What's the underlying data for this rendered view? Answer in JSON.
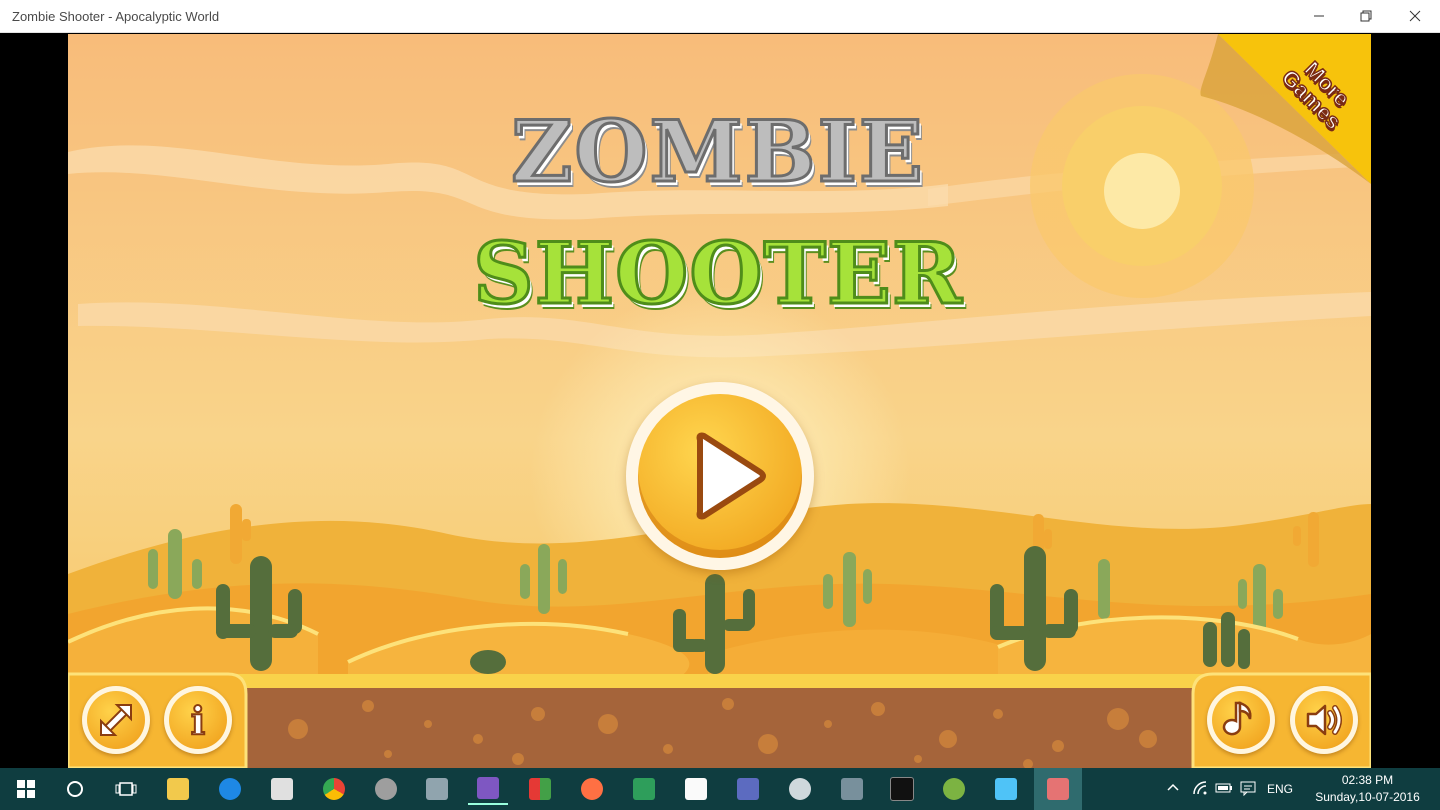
{
  "window": {
    "title": "Zombie Shooter - Apocalyptic World",
    "controls": [
      "minimize",
      "restore",
      "close"
    ]
  },
  "game": {
    "logo_line1": "ZOMBIE",
    "logo_line2": "SHOOTER",
    "more_games": {
      "line1": "More",
      "line2": "Games"
    },
    "buttons": {
      "play": "play-icon",
      "fullscreen": "expand-arrows-icon",
      "info": "i",
      "music": "music-note-icon",
      "sound": "speaker-icon"
    },
    "colors": {
      "sky": "#f8be7a",
      "button_orange": "#f5a623",
      "logo_grey": "#b8b8b8",
      "logo_green": "#a6e23a",
      "banner_yellow": "#f7c30c",
      "cactus": "#4f6b3a"
    }
  },
  "taskbar": {
    "apps": [
      "windows-start-icon",
      "cortana-icon",
      "task-view-icon",
      "file-explorer-icon",
      "edge-icon",
      "calculator-icon",
      "chrome-icon",
      "app-icon",
      "app-icon",
      "visual-studio-icon",
      "app-icon",
      "firefox-icon",
      "app-icon",
      "vnc-icon",
      "app-icon",
      "app-icon",
      "app-icon",
      "cmd-icon",
      "android-studio-icon",
      "app-icon",
      "zombie-shooter-icon"
    ],
    "language": "ENG",
    "time": "02:38 PM",
    "date": "Sunday,10-07-2016"
  }
}
